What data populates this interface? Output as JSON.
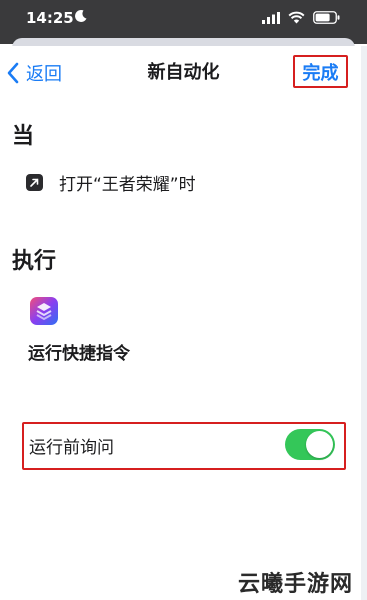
{
  "status_bar": {
    "time": "14:25"
  },
  "icons": {
    "moon": "moon-icon",
    "signal": "cellular-signal-icon",
    "wifi": "wifi-icon",
    "battery": "battery-icon",
    "back": "chevron-left-icon",
    "trigger": "open-app-arrow-icon",
    "action": "shortcuts-app-icon"
  },
  "nav": {
    "back_label": "返回",
    "title": "新自动化",
    "done_label": "完成"
  },
  "trigger_section": {
    "heading": "当",
    "trigger_label": "打开“王者荣耀”时"
  },
  "action_section": {
    "heading": "执行",
    "action_label": "运行快捷指令"
  },
  "ask_before_running": {
    "label": "运行前询问",
    "enabled": true
  },
  "colors": {
    "accent_blue": "#1a7cf5",
    "toggle_green": "#34c759",
    "highlight_red": "#d61f1f",
    "status_bar": "#3a3a3c"
  },
  "watermark": "云曦手游网"
}
